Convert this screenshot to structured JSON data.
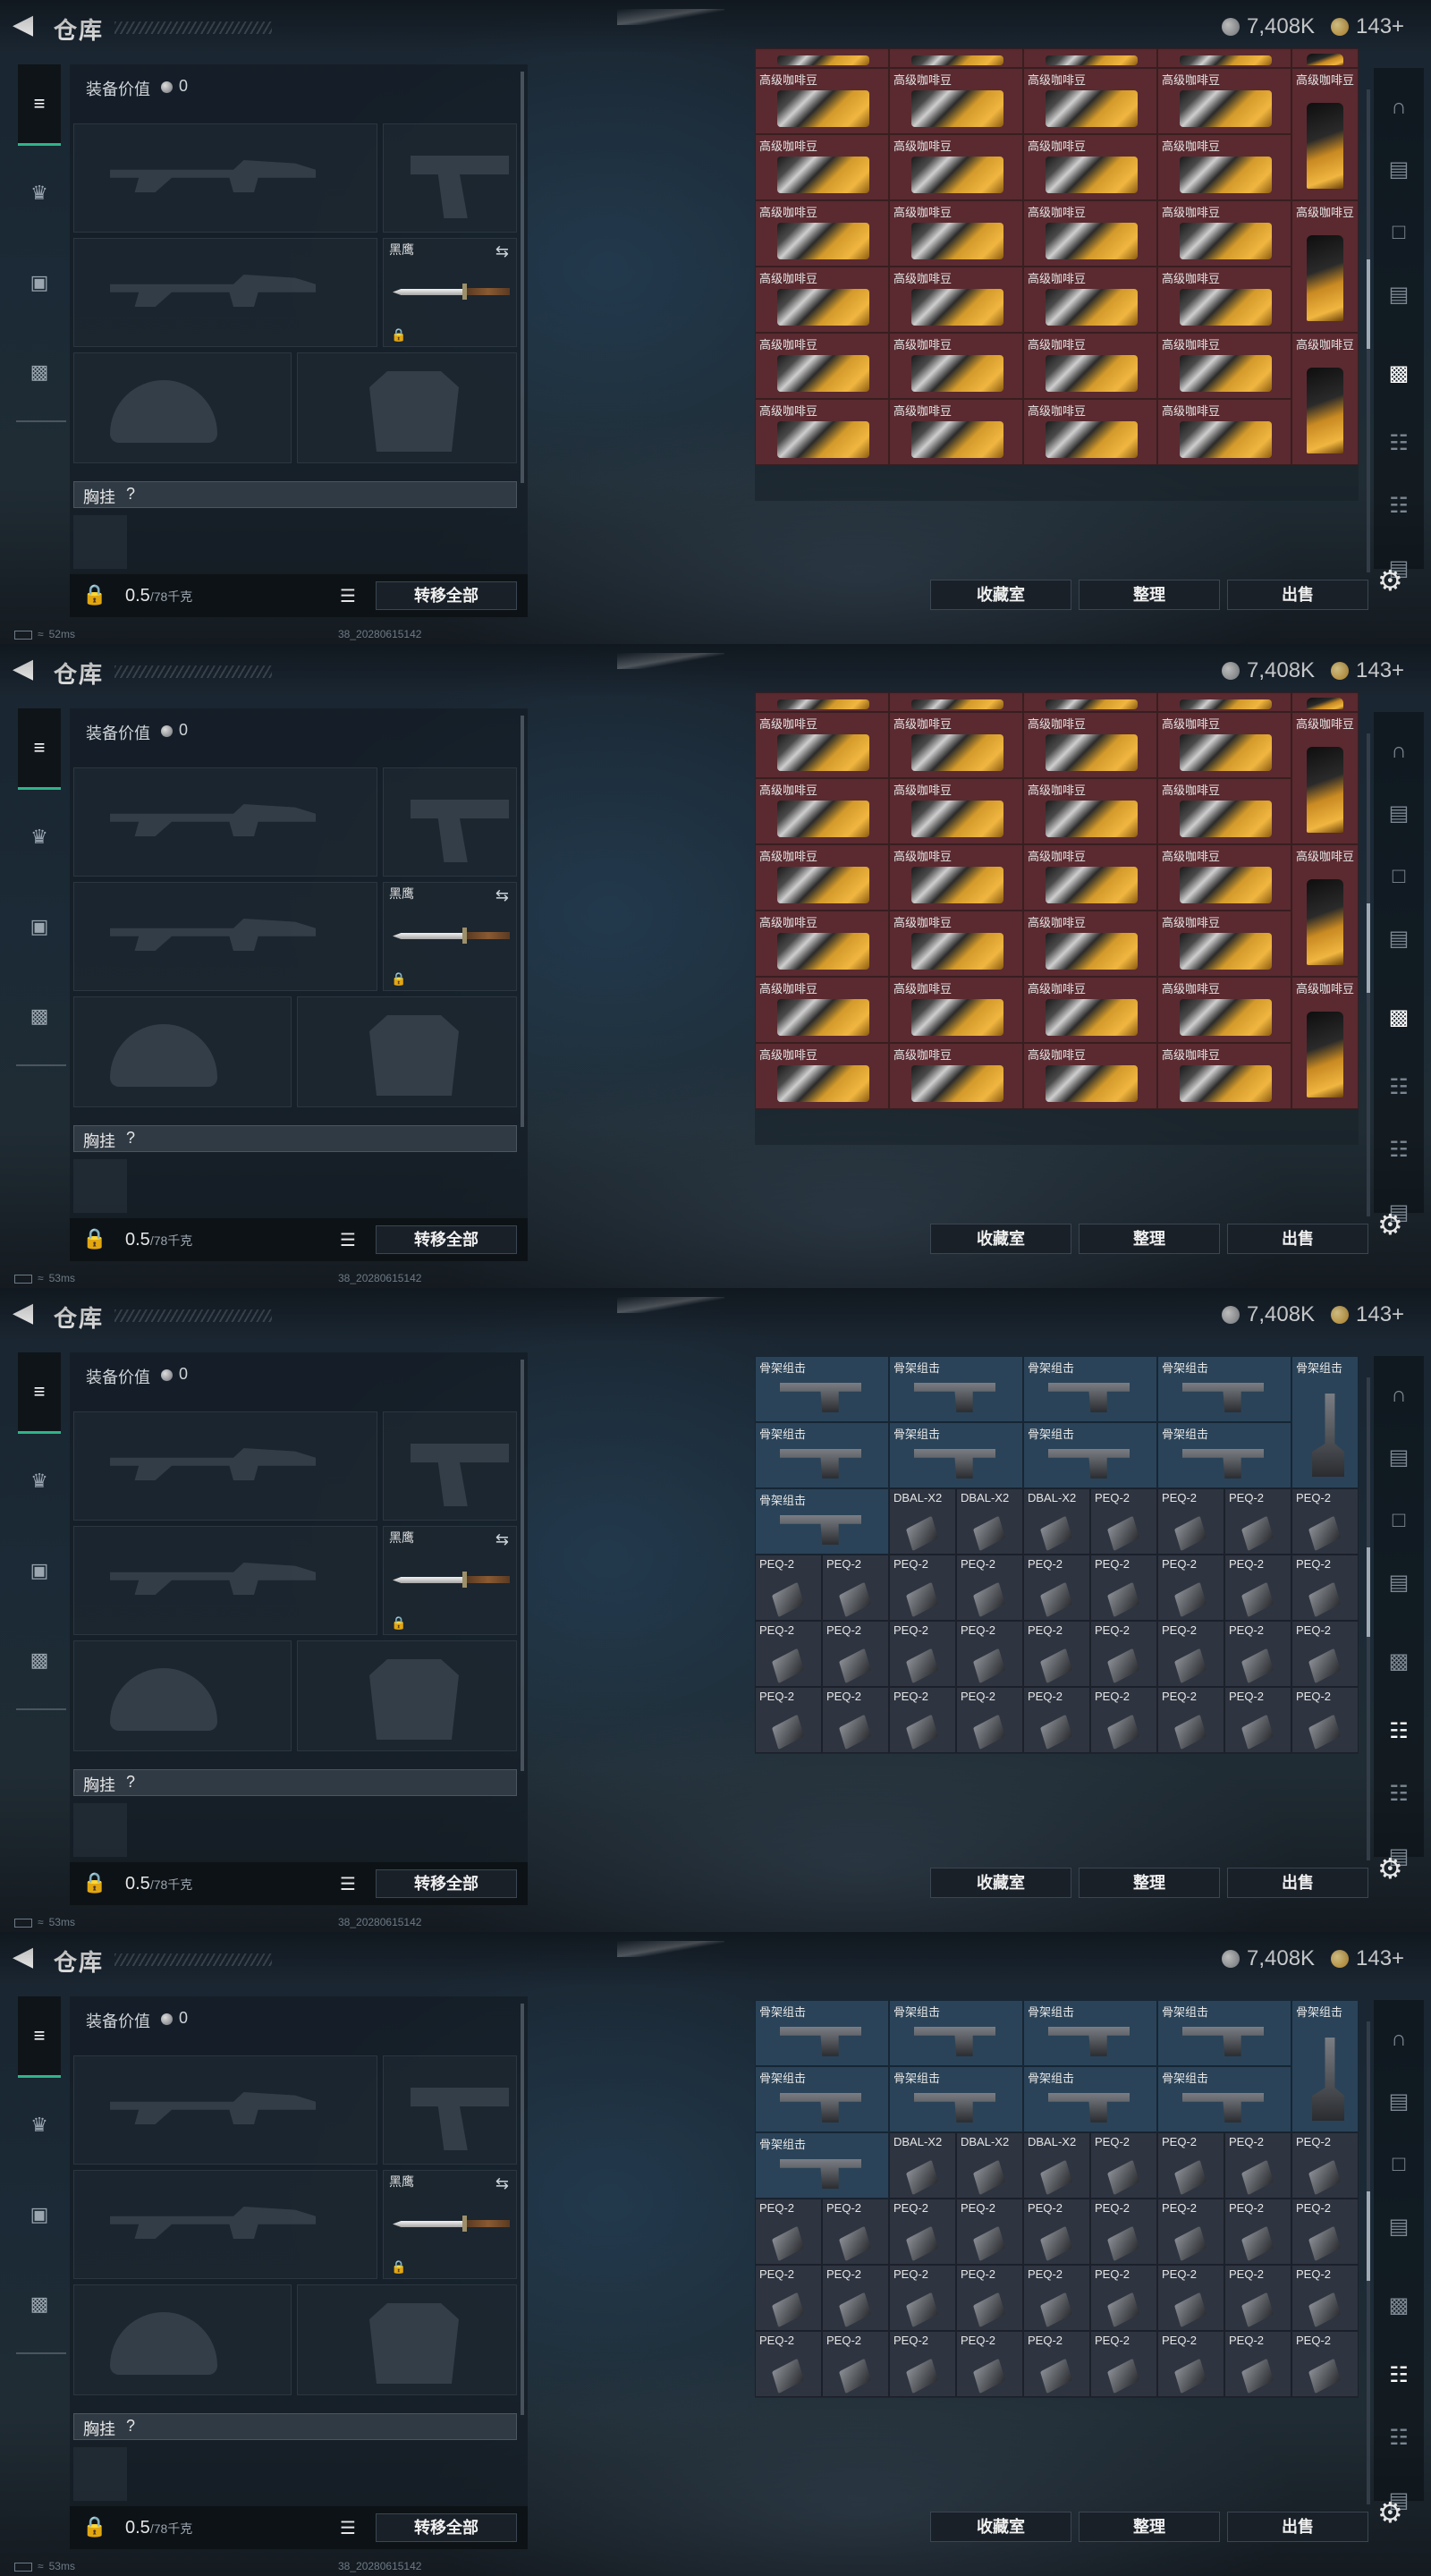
{
  "header": {
    "title": "仓库",
    "silver": "7,408K",
    "gold": "143+"
  },
  "equipment": {
    "value_label": "装备价值",
    "value": "0",
    "knife_name": "黑鹰",
    "rig_label": "胸挂",
    "rig_q": "?",
    "weight_value": "0.5",
    "weight_unit": "/78千克",
    "transfer_all": "转移全部"
  },
  "buttons": {
    "collection": "收藏室",
    "sort": "整理",
    "sell": "出售"
  },
  "status": {
    "id": "38_20280615142"
  },
  "panels": [
    {
      "variant": "coffee",
      "ping": "52ms",
      "active_rail": 4
    },
    {
      "variant": "coffee",
      "ping": "53ms",
      "active_rail": 4
    },
    {
      "variant": "attach",
      "ping": "53ms",
      "active_rail": 5
    },
    {
      "variant": "attach",
      "ping": "53ms",
      "active_rail": 5
    }
  ],
  "items": {
    "coffee_label": "高级咖啡豆",
    "stock_label": "骨架组击",
    "dbal_label": "DBAL-X2",
    "peq_label": "PEQ-2"
  },
  "icons": {
    "back": "back-arrow-icon",
    "rail": [
      "map-icon",
      "ammo-icon",
      "tv-icon",
      "ammo-box-icon",
      "camera-icon",
      "grip-icon",
      "rail-mount-icon",
      "scope-icon"
    ]
  }
}
